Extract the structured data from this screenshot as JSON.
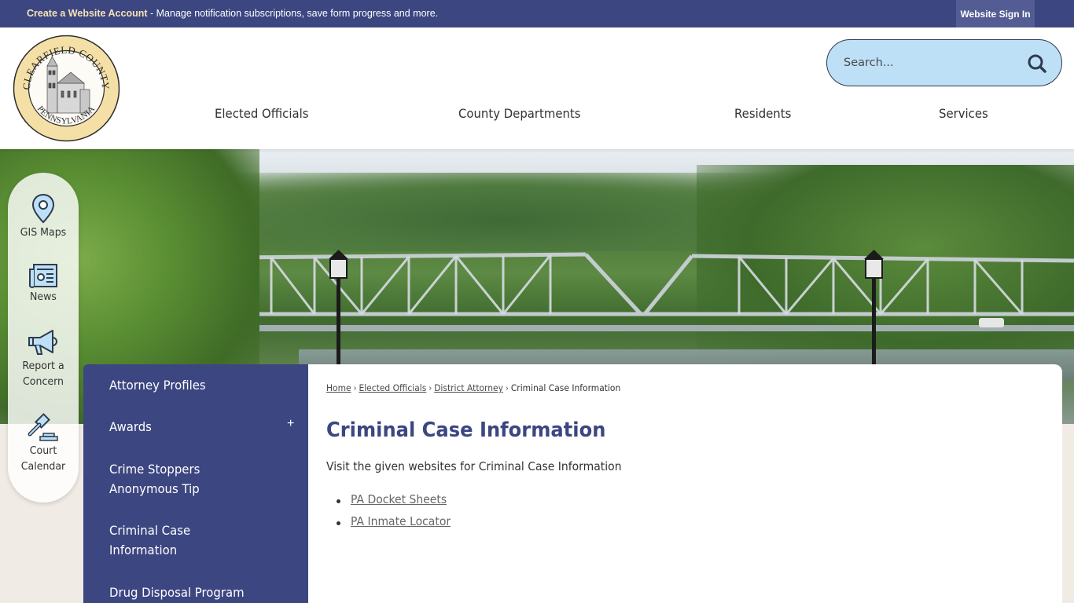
{
  "topbar": {
    "account_link": "Create a Website Account",
    "account_desc": " - Manage notification subscriptions, save form progress and more.",
    "signin_label": "Website Sign In"
  },
  "header": {
    "logo_top_text": "CLEARFIELD COUNTY",
    "logo_bottom_text": "PENNSYLVANIA",
    "search_placeholder": "Search...",
    "nav": [
      {
        "label": "Elected Officials"
      },
      {
        "label": "County Departments"
      },
      {
        "label": "Residents"
      },
      {
        "label": "Services"
      }
    ]
  },
  "quick_links": [
    {
      "label_line1": "GIS Maps",
      "label_line2": "",
      "icon": "map-pin-icon"
    },
    {
      "label_line1": "News",
      "label_line2": "",
      "icon": "newspaper-icon"
    },
    {
      "label_line1": "Report a",
      "label_line2": "Concern",
      "icon": "megaphone-icon"
    },
    {
      "label_line1": "Court",
      "label_line2": "Calendar",
      "icon": "gavel-icon"
    }
  ],
  "sidenav": {
    "items": [
      {
        "line1": "Attorney Profiles",
        "line2": ""
      },
      {
        "line1": "Awards",
        "line2": "",
        "expand": "+"
      },
      {
        "line1": "Crime Stoppers",
        "line2": "Anonymous Tip"
      },
      {
        "line1": "Criminal Case",
        "line2": "Information"
      },
      {
        "line1": "Drug Disposal Program",
        "line2": ""
      }
    ]
  },
  "content": {
    "breadcrumb": [
      {
        "label": "Home"
      },
      {
        "label": "Elected Officials"
      },
      {
        "label": "District Attorney"
      },
      {
        "label": "Criminal Case Information"
      }
    ],
    "breadcrumb_sep": "›",
    "title": "Criminal Case Information",
    "intro": "Visit the given websites for Criminal Case Information",
    "links": [
      {
        "label": "PA Docket Sheets"
      },
      {
        "label": "PA Inmate Locator"
      }
    ]
  },
  "colors": {
    "brand_navy": "#3c4681",
    "signin_bg": "#535d94",
    "search_bg": "#bde0f6",
    "account_link": "#f6e3b4",
    "page_bg": "#f1ebe5"
  }
}
